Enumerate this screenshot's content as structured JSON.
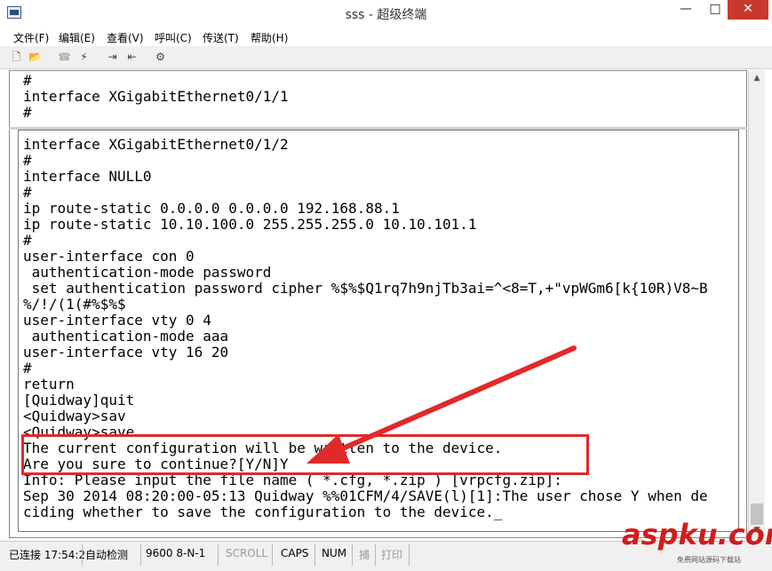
{
  "window": {
    "title": "sss - 超级终端",
    "minimize": "—",
    "maximize": "□",
    "close": "✕"
  },
  "menu": [
    "文件(F)",
    "编辑(E)",
    "查看(V)",
    "呼叫(C)",
    "传送(T)",
    "帮助(H)"
  ],
  "toolbar": {
    "icons": [
      "new-file-icon",
      "open-folder-icon",
      "disconnect-phone-icon",
      "connect-phone-icon",
      "send-icon",
      "receive-icon",
      "properties-icon"
    ]
  },
  "terminal": {
    "top_lines": [
      "#",
      "interface XGigabitEthernet0/1/1",
      "#"
    ],
    "lines": [
      "interface XGigabitEthernet0/1/2",
      "#",
      "interface NULL0",
      "#",
      "ip route-static 0.0.0.0 0.0.0.0 192.168.88.1",
      "ip route-static 10.10.100.0 255.255.255.0 10.10.101.1",
      "#",
      "user-interface con 0",
      " authentication-mode password",
      " set authentication password cipher %$%$Q1rq7h9njTb3ai=^<8=T,+\"vpWGm6[k{10R)V8~B",
      "%/!/(1(#%$%$",
      "user-interface vty 0 4",
      " authentication-mode aaa",
      "user-interface vty 16 20",
      "#",
      "return",
      "[Quidway]quit",
      "<Quidway>sav",
      "<Quidway>save",
      "The current configuration will be written to the device.",
      "Are you sure to continue?[Y/N]Y",
      "Info: Please input the file name ( *.cfg, *.zip ) [vrpcfg.zip]:",
      "Sep 30 2014 08:20:00-05:13 Quidway %%01CFM/4/SAVE(l)[1]:The user chose Y when de",
      "ciding whether to save the configuration to the device._"
    ]
  },
  "statusbar": {
    "connected": "已连接 17:54:2",
    "auto_detect": "自动检测",
    "port": "9600 8-N-1",
    "scroll": "SCROLL",
    "caps": "CAPS",
    "num": "NUM",
    "capture": "捕",
    "print": "打印"
  },
  "watermark": {
    "text": "aspku.com",
    "sub": "免费网站源码下载站"
  },
  "colors": {
    "highlight": "#e02a2a",
    "close_button": "#c7392b"
  }
}
